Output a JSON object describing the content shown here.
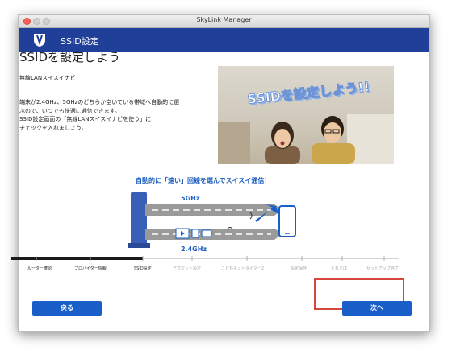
{
  "window": {
    "title": "SkyLink Manager"
  },
  "header": {
    "title": "SSID設定"
  },
  "main": {
    "heading": "SSIDを設定しよう",
    "subheading": "無線LANスイスイナビ",
    "desc_lines": [
      "端末が2.4GHz、5GHzのどちらか空いている帯域へ自動的に選",
      "ぶので、いつでも快適に通信できます。",
      "SSID設定画面の「無線LANスイスイナビを使う」に",
      "チェックを入れましょう。"
    ],
    "photo_caption": "SSIDを設定しよう!!"
  },
  "diagram": {
    "title": "自動的に「速い」回線を選んでスイスイ通信！",
    "band_5": "5GHz",
    "band_24": "2.4GHz"
  },
  "steps": [
    {
      "label": "ルーター確認",
      "state": "done"
    },
    {
      "label": "プロバイダー情報",
      "state": "done"
    },
    {
      "label": "SSID設定",
      "state": "current"
    },
    {
      "label": "アカウント設定",
      "state": "todo"
    },
    {
      "label": "こどもネットタイマー2",
      "state": "todo"
    },
    {
      "label": "設定保存",
      "state": "todo"
    },
    {
      "label": "えれさぼ",
      "state": "todo"
    },
    {
      "label": "セットアップ完了",
      "state": "todo"
    }
  ],
  "buttons": {
    "back": "戻る",
    "next": "次へ"
  },
  "colors": {
    "header": "#1f3f98",
    "button": "#1a5fc9",
    "highlight": "#d8473d"
  }
}
